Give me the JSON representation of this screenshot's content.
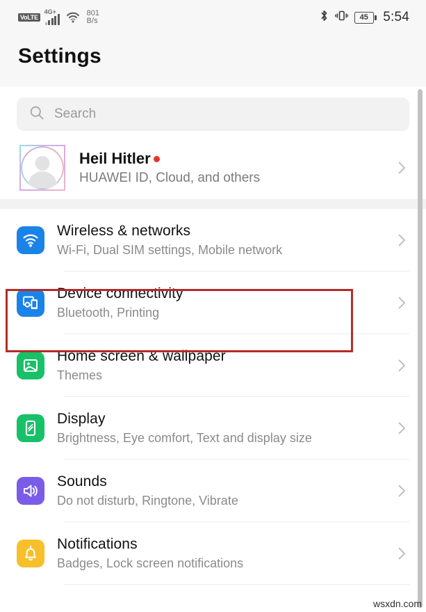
{
  "status_bar": {
    "volte_label": "VoLTE",
    "network_type": "4G+",
    "network_speed_value": "801",
    "network_speed_unit": "B/s",
    "signal_bars": 5,
    "wifi_icon": "wifi-icon",
    "bluetooth_icon": "bluetooth-icon",
    "vibrate_icon": "vibrate-icon",
    "battery_level": "45",
    "time": "5:54"
  },
  "header": {
    "title": "Settings"
  },
  "search": {
    "icon": "search-icon",
    "placeholder": "Search",
    "value": ""
  },
  "profile": {
    "avatar_icon": "avatar-placeholder-icon",
    "name": "Heil Hitler",
    "has_notification_dot": true,
    "subtitle": "HUAWEI ID, Cloud, and others",
    "chevron_icon": "chevron-right-icon"
  },
  "settings_list": [
    {
      "title": "Wireless & networks",
      "subtitle": "Wi-Fi, Dual SIM settings, Mobile network",
      "icon": "wifi-icon",
      "icon_color": "#1a83e8",
      "highlighted": false
    },
    {
      "title": "Device connectivity",
      "subtitle": "Bluetooth, Printing",
      "icon": "devices-icon",
      "icon_color": "#1a83e8",
      "highlighted": true
    },
    {
      "title": "Home screen & wallpaper",
      "subtitle": "Themes",
      "icon": "image-icon",
      "icon_color": "#18c168",
      "highlighted": false
    },
    {
      "title": "Display",
      "subtitle": "Brightness, Eye comfort, Text and display size",
      "icon": "phone-display-icon",
      "icon_color": "#18c168",
      "highlighted": false
    },
    {
      "title": "Sounds",
      "subtitle": "Do not disturb, Ringtone, Vibrate",
      "icon": "speaker-icon",
      "icon_color": "#7b5ce8",
      "highlighted": false
    },
    {
      "title": "Notifications",
      "subtitle": "Badges, Lock screen notifications",
      "icon": "bell-icon",
      "icon_color": "#f7c02a",
      "highlighted": false
    }
  ],
  "highlight_color": "#b52b28",
  "scrollbar": {
    "name": "vertical-scrollbar"
  },
  "watermark": "wsxdn.com"
}
